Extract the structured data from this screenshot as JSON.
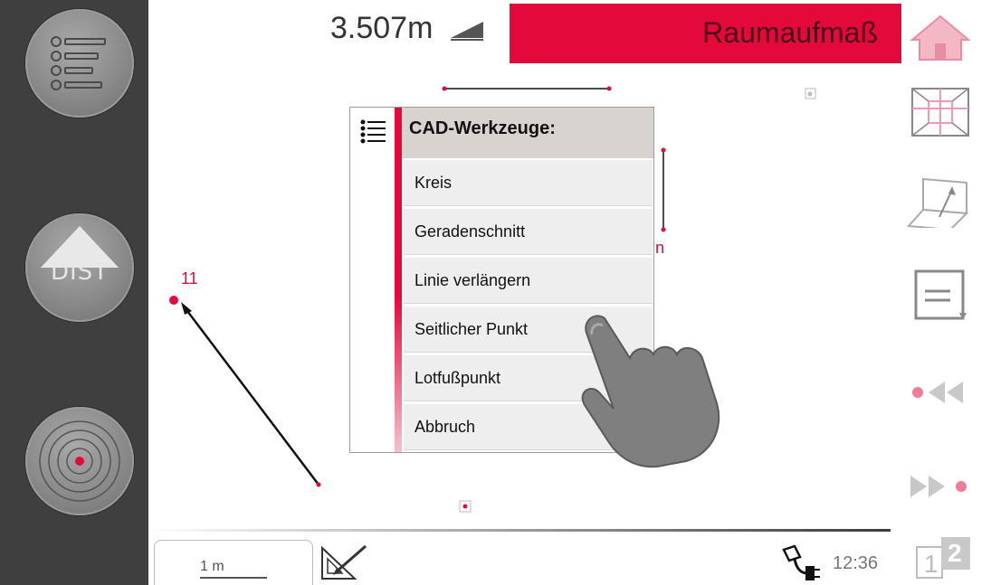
{
  "header": {
    "distance": "3.507m",
    "title": "Raumaufmaß"
  },
  "left_rail": {
    "buttons": [
      {
        "name": "menu-list",
        "icon": "list-icon"
      },
      {
        "name": "dist",
        "label": "DIST",
        "icon": "triangle-up-icon"
      },
      {
        "name": "target",
        "icon": "target-icon"
      }
    ]
  },
  "menu": {
    "title": "CAD-Werkzeuge:",
    "items": [
      "Kreis",
      "Geradenschnitt",
      "Linie verlängern",
      "Seitlicher Punkt",
      "Lotfußpunkt",
      "Abbruch"
    ]
  },
  "canvas": {
    "point_label": "11",
    "partial_label": "n"
  },
  "right_rail": {
    "icons": [
      "home-icon",
      "room-plan-icon",
      "3d-plane-icon",
      "note-icon",
      "rewind-icon",
      "forward-icon",
      "page-indicator-icon"
    ]
  },
  "footer": {
    "scale": "1 m",
    "time": "12:36",
    "page_current": "1",
    "page_next": "2"
  },
  "colors": {
    "accent": "#e4093b",
    "rail": "#3f3f3f"
  }
}
